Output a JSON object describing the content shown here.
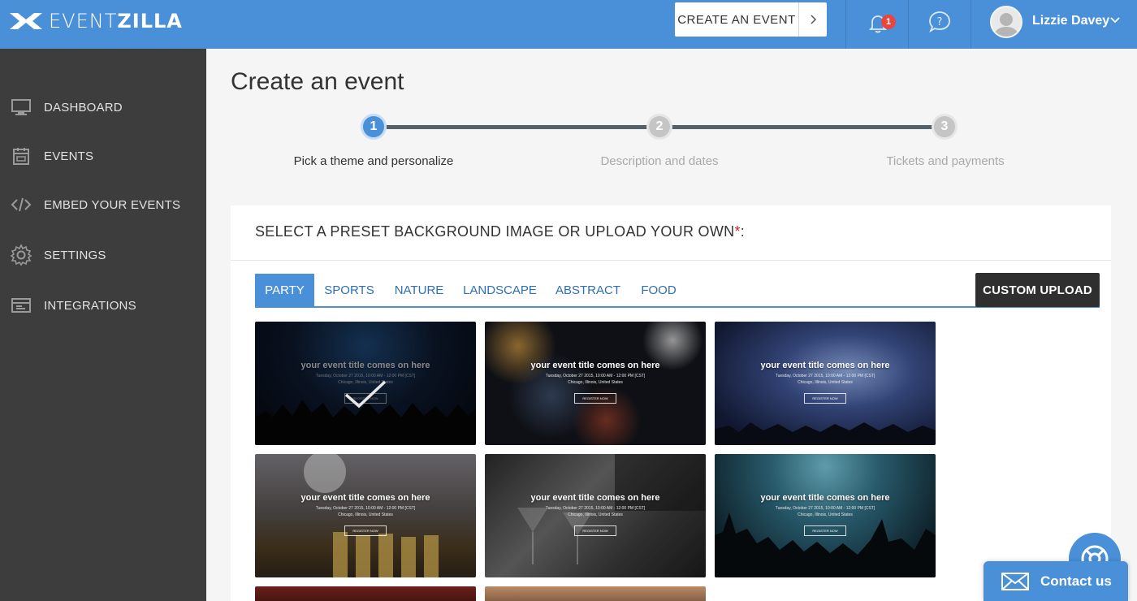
{
  "brand": {
    "logo_text_light": "EVENT",
    "logo_text_bold": "ZILLA"
  },
  "topbar": {
    "create_label": "CREATE AN EVENT",
    "notifications_count": "1",
    "user_name": "Lizzie Davey"
  },
  "sidebar": {
    "items": [
      {
        "label": "DASHBOARD",
        "icon": "monitor-icon"
      },
      {
        "label": "EVENTS",
        "icon": "calendar-icon"
      },
      {
        "label": "EMBED YOUR EVENTS",
        "icon": "code-icon"
      },
      {
        "label": "SETTINGS",
        "icon": "gear-icon"
      },
      {
        "label": "INTEGRATIONS",
        "icon": "integrations-icon"
      }
    ]
  },
  "page": {
    "title": "Create an event"
  },
  "stepper": {
    "steps": [
      {
        "number": "1",
        "label": "Pick a theme and personalize",
        "state": "active"
      },
      {
        "number": "2",
        "label": "Description and dates",
        "state": "inactive"
      },
      {
        "number": "3",
        "label": "Tickets and payments",
        "state": "inactive"
      }
    ]
  },
  "panel": {
    "title": "SELECT A PRESET BACKGROUND IMAGE OR UPLOAD YOUR OWN",
    "required_mark": "*",
    "colon": ":",
    "tabs": [
      "PARTY",
      "SPORTS",
      "NATURE",
      "LANDSCAPE",
      "ABSTRACT",
      "FOOD"
    ],
    "active_tab": "PARTY",
    "upload_label": "CUSTOM UPLOAD"
  },
  "thumbs": {
    "title": "your event title comes on here",
    "meta": "Tuesday, October 27 2015, 10:00 AM - 12:00 PM [CST]",
    "location": "Chicago, Illinois, United States",
    "register": "REGISTER NOW",
    "selected_index": 0
  },
  "contact": {
    "label": "Contact us"
  },
  "colors": {
    "primary": "#4a90d9",
    "sidebar": "#3d3d3d",
    "dark_button": "#2f2f2f",
    "badge": "#e8473f"
  }
}
